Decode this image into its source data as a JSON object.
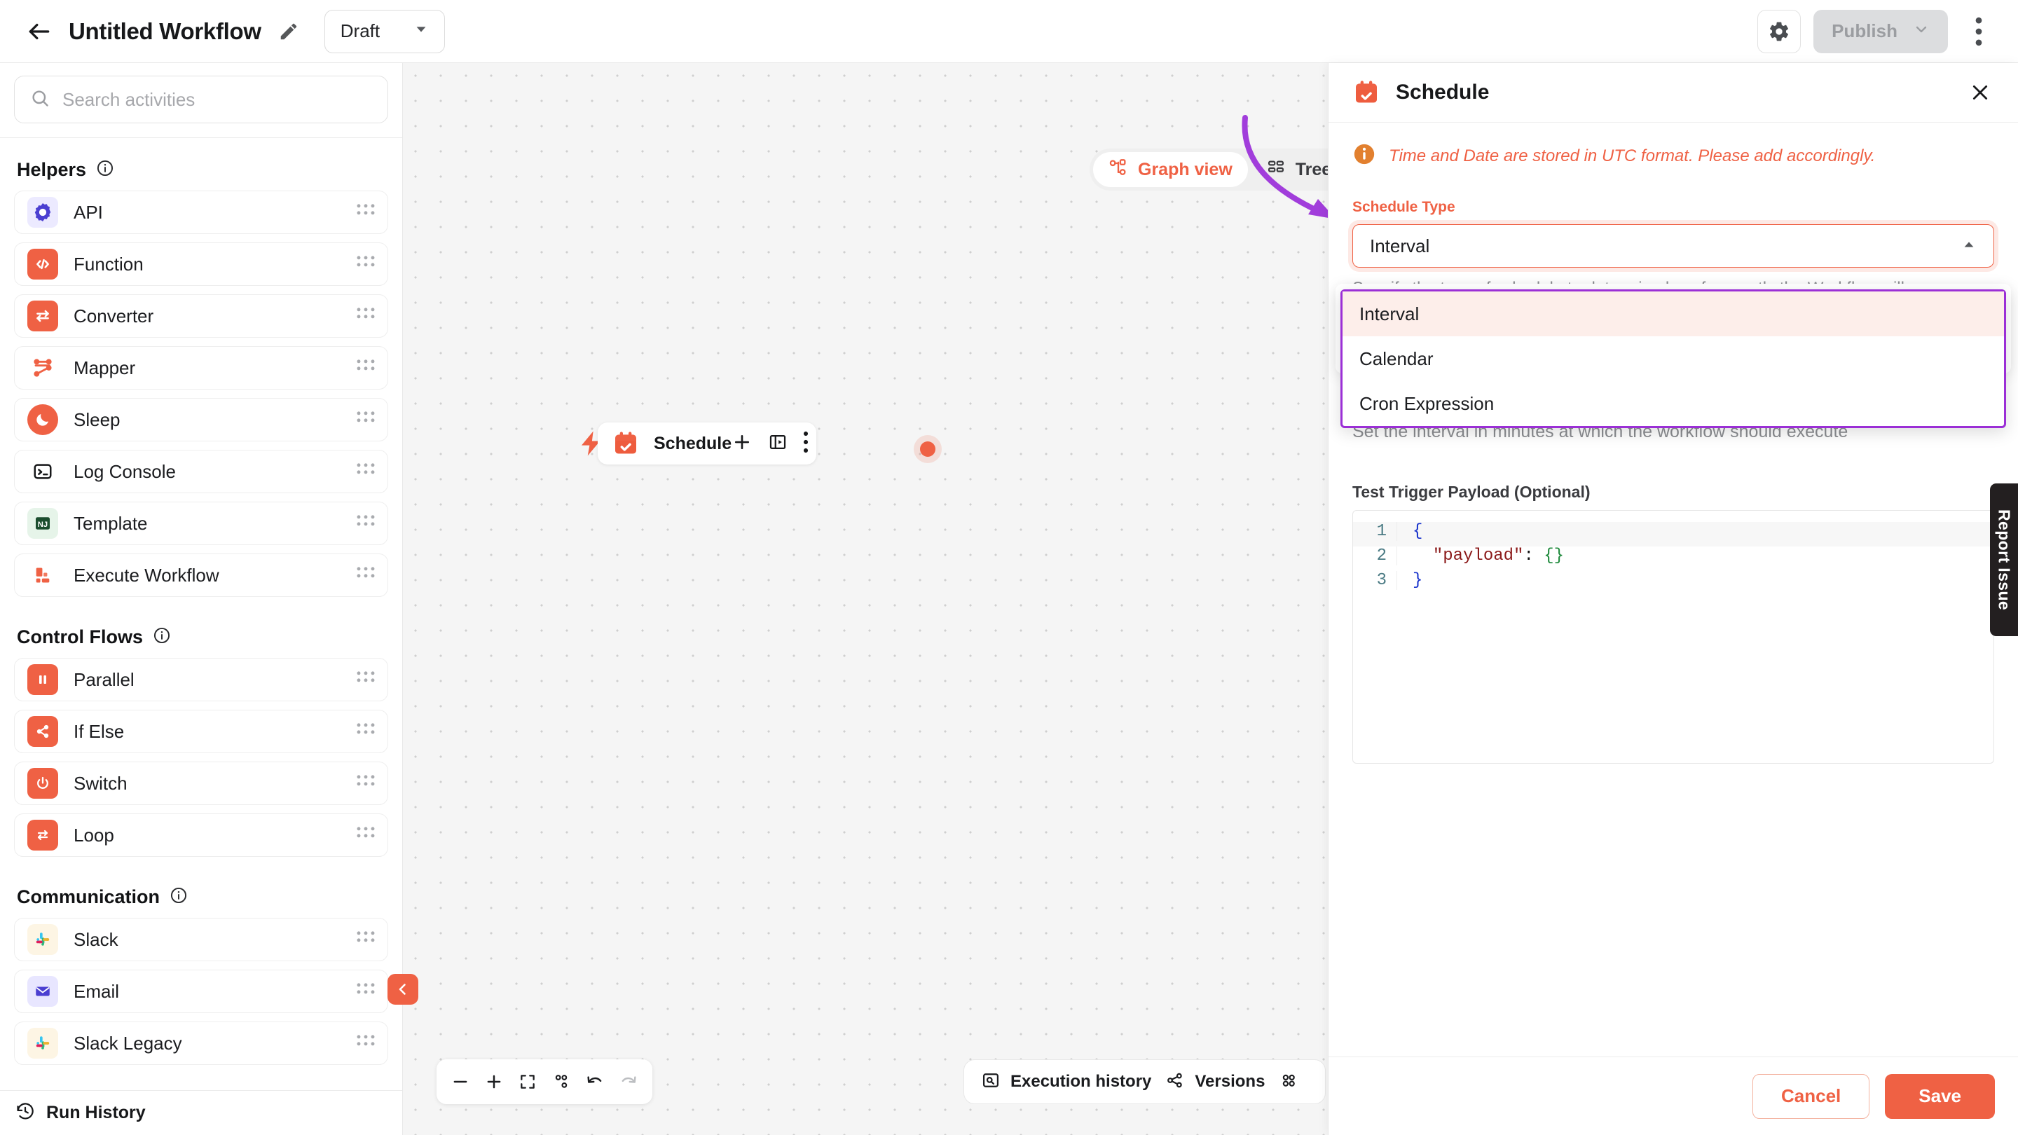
{
  "topbar": {
    "back_icon": "arrow-left-icon",
    "workflow_title": "Untitled Workflow",
    "edit_icon": "pencil-icon",
    "status": "Draft",
    "settings_icon": "gear-icon",
    "publish_label": "Publish",
    "kebab_icon": "more-vertical-icon"
  },
  "sidebar": {
    "search": {
      "placeholder": "Search activities",
      "value": "",
      "icon": "search-icon"
    },
    "sections": [
      {
        "title": "Helpers",
        "info_icon": "info-circle-icon",
        "items": [
          {
            "label": "API",
            "icon": "api-icon"
          },
          {
            "label": "Function",
            "icon": "code-brackets-icon"
          },
          {
            "label": "Converter",
            "icon": "convert-arrows-icon"
          },
          {
            "label": "Mapper",
            "icon": "mapper-nodes-icon"
          },
          {
            "label": "Sleep",
            "icon": "moon-icon"
          },
          {
            "label": "Log Console",
            "icon": "terminal-icon"
          },
          {
            "label": "Template",
            "icon": "nunjucks-icon"
          },
          {
            "label": "Execute Workflow",
            "icon": "blocks-icon"
          }
        ]
      },
      {
        "title": "Control Flows",
        "info_icon": "info-circle-icon",
        "items": [
          {
            "label": "Parallel",
            "icon": "pause-bars-icon"
          },
          {
            "label": "If Else",
            "icon": "branch-icon"
          },
          {
            "label": "Switch",
            "icon": "power-icon"
          },
          {
            "label": "Loop",
            "icon": "loop-arrows-icon"
          }
        ]
      },
      {
        "title": "Communication",
        "info_icon": "info-circle-icon",
        "items": [
          {
            "label": "Slack",
            "icon": "slack-icon"
          },
          {
            "label": "Email",
            "icon": "envelope-icon"
          },
          {
            "label": "Slack Legacy",
            "icon": "slack-icon"
          }
        ]
      }
    ],
    "drag_handle_icon": "drag-grip-icon",
    "run_history": {
      "label": "Run History",
      "icon": "history-clock-icon"
    },
    "collapse_icon": "chevron-left-icon"
  },
  "canvas": {
    "view_toggle": [
      {
        "label": "Graph view",
        "icon": "graph-nodes-icon",
        "active": true
      },
      {
        "label": "Tree v",
        "icon": "tree-list-icon",
        "active": false
      }
    ],
    "node": {
      "label": "Schedule",
      "icon": "calendar-check-icon",
      "trigger_icon": "lightning-bolt-icon",
      "add_icon": "plus-icon",
      "panel_icon": "sidepanel-icon",
      "menu_icon": "more-vertical-icon",
      "output_port": "output-connector-dot"
    },
    "zoom_controls": [
      {
        "icon": "minus-icon"
      },
      {
        "icon": "plus-icon"
      },
      {
        "icon": "fit-screen-icon"
      },
      {
        "icon": "layout-auto-icon"
      },
      {
        "icon": "undo-icon"
      },
      {
        "icon": "redo-icon"
      }
    ],
    "bottom_bar": [
      {
        "label": "Execution history",
        "icon": "execution-history-icon"
      },
      {
        "label": "Versions",
        "icon": "versions-icon"
      },
      {
        "label": "",
        "icon": "grid-dots-icon"
      }
    ],
    "annotation": {
      "type": "curved-arrow",
      "color": "#a13ddb"
    }
  },
  "panel": {
    "title": "Schedule",
    "icon": "calendar-check-icon",
    "close_icon": "close-icon",
    "notice": {
      "icon": "info-filled-icon",
      "text": "Time and Date are stored in UTC format. Please add accordingly."
    },
    "schedule_type": {
      "label": "Schedule Type",
      "value": "Interval",
      "caret_icon": "caret-up-icon",
      "helper": "Specify the type of schedule to determine how frequently the Workflow will",
      "options": [
        {
          "label": "Interval",
          "selected": true
        },
        {
          "label": "Calendar",
          "selected": false
        },
        {
          "label": "Cron Expression",
          "selected": false
        }
      ],
      "highlight_color": "#9b2fd6"
    },
    "interval_helper": "Set the interval in minutes at which the workflow should execute",
    "payload": {
      "label": "Test Trigger Payload (Optional)",
      "lines": [
        {
          "no": "1",
          "brace": "{",
          "key": "",
          "colon": "",
          "obj": ""
        },
        {
          "no": "2",
          "brace": "",
          "key": "\"payload\"",
          "colon": ":",
          "obj": "{}"
        },
        {
          "no": "3",
          "brace": "}",
          "key": "",
          "colon": "",
          "obj": ""
        }
      ]
    },
    "footer": {
      "cancel_label": "Cancel",
      "save_label": "Save"
    },
    "accent_color": "#ef6144"
  },
  "report_issue": {
    "label": "Report Issue"
  }
}
